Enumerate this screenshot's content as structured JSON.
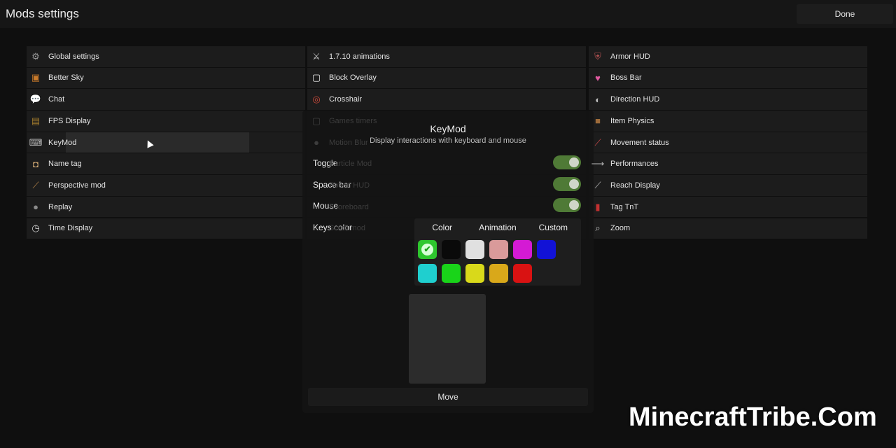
{
  "header": {
    "title": "Mods settings",
    "done_label": "Done"
  },
  "columns": [
    [
      {
        "label": "Global settings",
        "icon": "gear-icon",
        "glyph": "⚙",
        "color": "#9a9a9a"
      },
      {
        "label": "Better Sky",
        "icon": "sky-icon",
        "glyph": "▣",
        "color": "#c97a2a"
      },
      {
        "label": "Chat",
        "icon": "chat-bubble-icon",
        "glyph": "💬",
        "color": "#cfcfcf"
      },
      {
        "label": "FPS Display",
        "icon": "fps-icon",
        "glyph": "▤",
        "color": "#a07a2c"
      },
      {
        "label": "KeyMod",
        "icon": "keyboard-icon",
        "glyph": "⌨",
        "color": "#bdbdbd"
      },
      {
        "label": "Name tag",
        "icon": "name-tag-icon",
        "glyph": "◘",
        "color": "#d1a873"
      },
      {
        "label": "Perspective mod",
        "icon": "perspective-icon",
        "glyph": "⟋",
        "color": "#b8864b"
      },
      {
        "label": "Replay",
        "icon": "replay-camera-icon",
        "glyph": "●",
        "color": "#8a8a8a"
      },
      {
        "label": "Time Display",
        "icon": "clock-icon",
        "glyph": "◷",
        "color": "#d9d9d9"
      }
    ],
    [
      {
        "label": "1.7.10 animations",
        "icon": "crossed-swords-icon",
        "glyph": "⚔",
        "color": "#cfcfcf"
      },
      {
        "label": "Block Overlay",
        "icon": "block-outline-icon",
        "glyph": "▢",
        "color": "#e6e6e6"
      },
      {
        "label": "Crosshair",
        "icon": "target-icon",
        "glyph": "◎",
        "color": "#d04a3a"
      },
      {
        "label": "Games timers",
        "icon": "timer-icon",
        "glyph": "▢",
        "color": "#3d3d3d",
        "dim": true
      },
      {
        "label": "Motion Blur",
        "icon": "motion-blur-icon",
        "glyph": "●",
        "color": "#3d3d3d",
        "dim": true
      },
      {
        "label": "Particle Mod",
        "icon": "particle-icon",
        "glyph": "·",
        "color": "#3d3d3d",
        "dim": true
      },
      {
        "label": "Potion HUD",
        "icon": "potion-icon",
        "glyph": "·",
        "color": "#3d3d3d",
        "dim": true
      },
      {
        "label": "Scoreboard",
        "icon": "scoreboard-icon",
        "glyph": "·",
        "color": "#3d3d3d",
        "dim": true
      },
      {
        "label": "Scroll mod",
        "icon": "scroll-icon",
        "glyph": "·",
        "color": "#3d3d3d",
        "dim": true
      }
    ],
    [
      {
        "label": "Armor HUD",
        "icon": "armor-icon",
        "glyph": "⛨",
        "color": "#b05050"
      },
      {
        "label": "Boss Bar",
        "icon": "heart-icon",
        "glyph": "♥",
        "color": "#e05aa0"
      },
      {
        "label": "Direction HUD",
        "icon": "compass-icon",
        "glyph": "◐",
        "color": "#bdbdbd"
      },
      {
        "label": "Item Physics",
        "icon": "item-box-icon",
        "glyph": "■",
        "color": "#9c6a3a"
      },
      {
        "label": "Movement status",
        "icon": "movement-icon",
        "glyph": "⟋",
        "color": "#d04a4a"
      },
      {
        "label": "Performances",
        "icon": "performance-icon",
        "glyph": "⟶",
        "color": "#bdbdbd"
      },
      {
        "label": "Reach Display",
        "icon": "sword-icon",
        "glyph": "⟋",
        "color": "#bdbdbd"
      },
      {
        "label": "Tag TnT",
        "icon": "tnt-icon",
        "glyph": "▮",
        "color": "#c23030"
      },
      {
        "label": "Zoom",
        "icon": "magnifier-icon",
        "glyph": "⌕",
        "color": "#bdbdbd"
      }
    ]
  ],
  "modal": {
    "title": "KeyMod",
    "description": "Display interactions with keyboard and mouse",
    "options": [
      {
        "label": "Toggle",
        "enabled": true
      },
      {
        "label": "Space bar",
        "enabled": true
      },
      {
        "label": "Mouse",
        "enabled": true
      }
    ],
    "keys_color_label": "Keys color",
    "tabs": [
      "Color",
      "Animation",
      "Custom"
    ],
    "swatches": [
      "#2ec72e",
      "#0a0a0a",
      "#e0e0e0",
      "#d99a9a",
      "#d41ad4",
      "#1212d6",
      "#1fcfcf",
      "#19d419",
      "#d9d91a",
      "#d9a81a",
      "#d91212"
    ],
    "selected_swatch": 0,
    "move_label": "Move"
  },
  "watermark": "MinecraftTribe.Com"
}
